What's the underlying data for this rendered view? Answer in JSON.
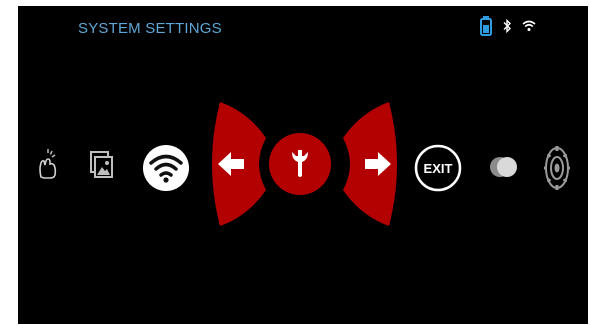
{
  "screen": {
    "title": "SYSTEM SETTINGS"
  },
  "status_bar": {
    "icons": [
      "battery-icon",
      "bluetooth-icon",
      "wifi-status-icon"
    ],
    "accent_color": "#2f9be0"
  },
  "menu": {
    "items": [
      {
        "name": "touch-hand-icon"
      },
      {
        "name": "gallery-icon"
      },
      {
        "name": "wifi-icon"
      },
      {
        "name": "left-arrow-icon"
      },
      {
        "name": "wrench-icon",
        "selected": true
      },
      {
        "name": "right-arrow-icon"
      },
      {
        "name": "exit-icon",
        "label": "EXIT"
      },
      {
        "name": "contrast-icon"
      },
      {
        "name": "settings-gear-icon"
      }
    ],
    "highlight_color": "#b30000"
  }
}
